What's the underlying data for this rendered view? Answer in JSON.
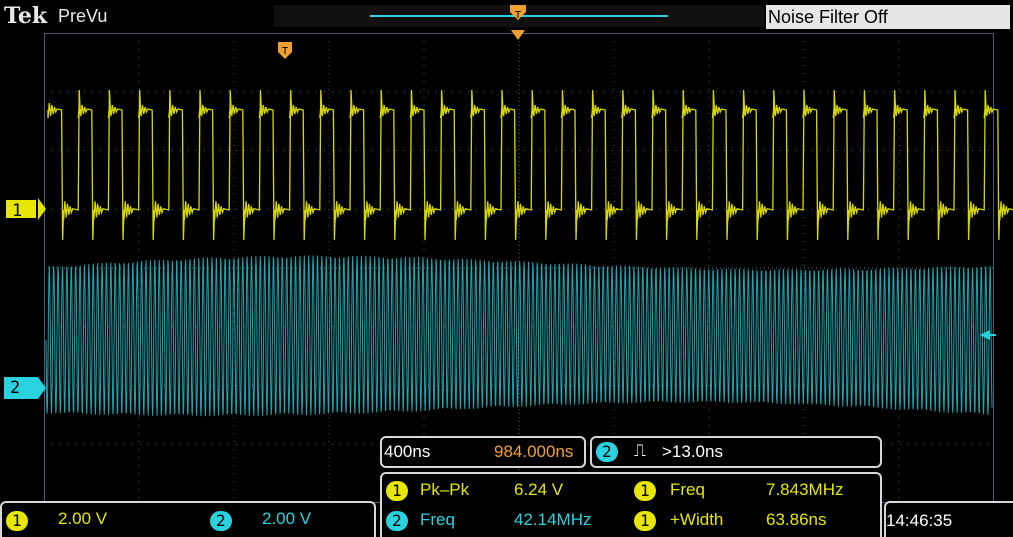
{
  "header": {
    "brand": "Tek",
    "mode": "PreVu",
    "noise_filter": "Noise Filter Off"
  },
  "channels": {
    "ch1": {
      "number": "1",
      "scale": "2.00 V",
      "color": "#e6e600"
    },
    "ch2": {
      "number": "2",
      "scale": "2.00 V",
      "color": "#2ad2e0"
    }
  },
  "timebase": {
    "scale": "400ns",
    "position": "984.000ns"
  },
  "trigger": {
    "source": "2",
    "symbol": "⎍",
    "condition": ">13.0ns"
  },
  "measurements": [
    {
      "channel": "1",
      "label": "Pk–Pk",
      "value": "6.24 V"
    },
    {
      "channel": "1",
      "label": "Freq",
      "value": "7.843MHz"
    },
    {
      "channel": "2",
      "label": "Freq",
      "value": "42.14MHz"
    },
    {
      "channel": "1",
      "label": "+Width",
      "value": "63.86ns"
    }
  ],
  "clock": "14:46:35",
  "icons": {
    "trigger_position": "trigger-t-icon",
    "ch1_marker": "arrow-right-icon",
    "ch2_marker": "arrow-right-icon"
  }
}
